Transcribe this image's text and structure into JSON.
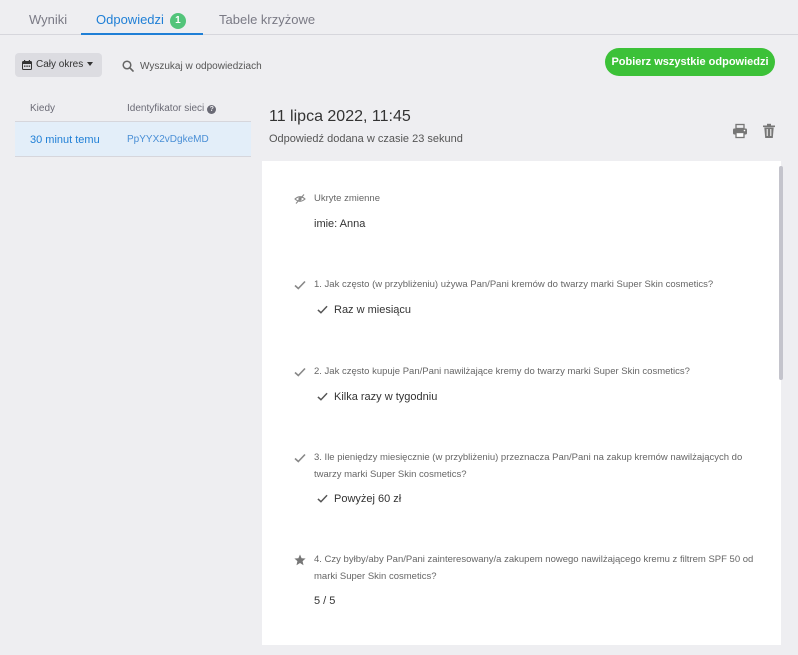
{
  "tabs": [
    {
      "label": "Wyniki"
    },
    {
      "label": "Odpowiedzi",
      "badge": "1"
    },
    {
      "label": "Tabele krzyżowe"
    }
  ],
  "toolbar": {
    "period_label": "Cały okres",
    "search_placeholder": "Wyszukaj w odpowiedziach",
    "download_label": "Pobierz wszystkie odpowiedzi"
  },
  "list": {
    "columns": [
      "Kiedy",
      "Identyfikator sieci"
    ],
    "rows": [
      {
        "when": "30 minut temu",
        "id": "PpYYX2vDgkeMD"
      }
    ]
  },
  "detail": {
    "date": "11 lipca 2022, 11:45",
    "subtitle": "Odpowiedź dodana w czasie 23 sekund",
    "hidden_vars_label": "Ukryte zmienne",
    "hidden_vars_value": "imie: Anna",
    "questions": [
      {
        "label": "1. Jak często (w przybliżeniu) używa Pan/Pani kremów do twarzy marki Super Skin cosmetics?",
        "answer": "Raz w miesiącu"
      },
      {
        "label": "2. Jak często kupuje Pan/Pani nawilżające kremy do twarzy marki Super Skin cosmetics?",
        "answer": "Kilka razy w tygodniu"
      },
      {
        "label": "3. Ile pieniędzy miesięcznie (w przybliżeniu) przeznacza Pan/Pani na zakup kremów nawilżających do twarzy marki Super Skin cosmetics?",
        "answer": "Powyżej 60 zł"
      },
      {
        "label": "4. Czy byłby/aby Pan/Pani zainteresowany/a zakupem nowego nawilżającego kremu z filtrem SPF 50 od marki Super Skin cosmetics?",
        "answer": "5 / 5"
      }
    ]
  },
  "colors": {
    "accent": "#1f7fd6",
    "download_button": "#3cc138",
    "badge": "#52c47a",
    "selected_row": "#e3eef9"
  },
  "icons": [
    "calendar-icon",
    "search-icon",
    "help-icon",
    "print-icon",
    "trash-icon",
    "eye-slash-icon",
    "check-icon",
    "star-icon"
  ]
}
